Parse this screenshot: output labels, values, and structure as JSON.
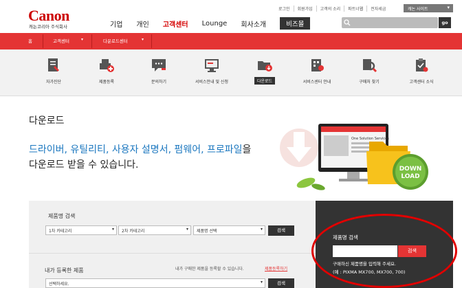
{
  "header": {
    "logo": "Canon",
    "logo_sub": "캐논코리아 주식회사",
    "nav": [
      "기업",
      "개인",
      "고객센터",
      "Lounge",
      "회사소개",
      "비즈몰"
    ],
    "top_links": [
      "로그인",
      "회원가입",
      "고객의 소리",
      "파트너웹",
      "전자세금"
    ],
    "site_select": "캐논 사이트",
    "search_button": "go"
  },
  "breadcrumb": [
    "홈",
    "고객센터",
    "다운로드센터"
  ],
  "subnav": [
    {
      "label": "자가진단",
      "icon": "self-diagnosis-icon"
    },
    {
      "label": "제품등록",
      "icon": "product-register-icon"
    },
    {
      "label": "문의하기",
      "icon": "inquiry-icon"
    },
    {
      "label": "서비스안내 및 신청",
      "icon": "service-guide-icon"
    },
    {
      "label": "다운로드",
      "icon": "download-folder-icon"
    },
    {
      "label": "서비스센터 안내",
      "icon": "service-center-icon"
    },
    {
      "label": "구매처 찾기",
      "icon": "store-search-icon"
    },
    {
      "label": "고객센터 소식",
      "icon": "news-icon"
    }
  ],
  "hero": {
    "title": "다운로드",
    "line1_highlight": "드라이버, 유틸리티, 사용자 설명서, 펌웨어, 프로파일",
    "line1_rest": "을",
    "line2": "다운로드 받을 수 있습니다.",
    "badge_line1": "DOWN",
    "badge_line2": "LOAD",
    "screen_text": "One Solution Services"
  },
  "search": {
    "product_search_title": "제품명 검색",
    "category1": "1차 카테고리",
    "category2": "2차 카테고리",
    "product_select": "제품명 선택",
    "search_label": "검색",
    "registered_title": "내가 등록한 제품",
    "registered_note": "내가 구매한 제품을 등록할 수 있습니다.",
    "registered_link": "제품등록하기",
    "registered_select": "선택하세요."
  },
  "name_search": {
    "title": "제품명 검색",
    "button": "검색",
    "hint_line1": "구매하신 제품명을 입력해 주세요.",
    "hint_line2": "(예 : PIXMA MX700, MX700, 700)"
  },
  "colors": {
    "brand_red": "#e43434",
    "dark": "#333333",
    "highlight_blue": "#1b77bf"
  }
}
